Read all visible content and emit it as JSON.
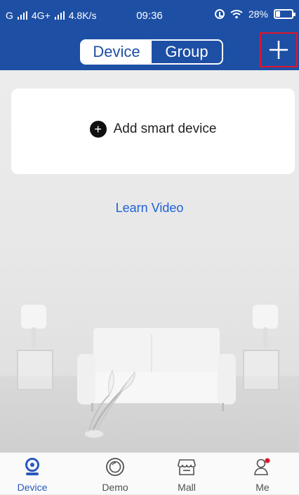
{
  "colors": {
    "brand": "#1d4fa5",
    "highlight_border": "#e0152d",
    "link": "#1f61d9",
    "tab_active": "#2a58bd",
    "tab_inactive": "#4f4f4f",
    "notification_dot": "#e0152d"
  },
  "status_bar": {
    "network_left": "G",
    "network_mid": "4G+",
    "speed": "4.8K/s",
    "time": "09:36",
    "battery_percent": "28%",
    "battery_level": 0.28,
    "icons": [
      "signal-icon",
      "alarm-icon",
      "wifi-icon",
      "battery-icon"
    ]
  },
  "header": {
    "segment": {
      "tabs": [
        {
          "label": "Device",
          "active": true
        },
        {
          "label": "Group",
          "active": false
        }
      ]
    },
    "add_icon": "plus-icon"
  },
  "main": {
    "add_device_label": "Add smart device",
    "add_device_icon": "plus-circle-icon",
    "learn_video_label": "Learn Video"
  },
  "tabbar": {
    "items": [
      {
        "label": "Device",
        "icon": "camera-icon",
        "active": true
      },
      {
        "label": "Demo",
        "icon": "lens-icon",
        "active": false
      },
      {
        "label": "Mall",
        "icon": "store-icon",
        "active": false
      },
      {
        "label": "Me",
        "icon": "person-icon",
        "active": false,
        "badge": true
      }
    ]
  }
}
